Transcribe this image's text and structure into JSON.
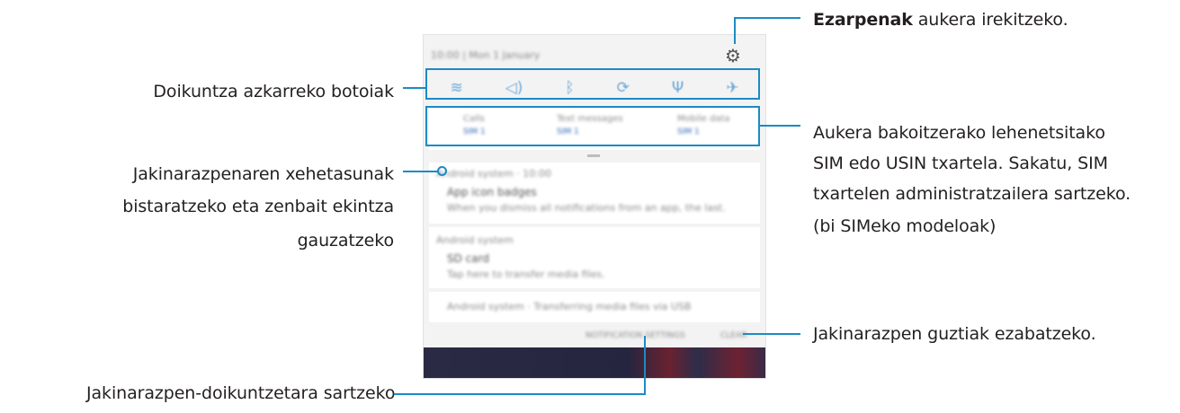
{
  "annotations": {
    "quick_buttons": "Doikuntza azkarreko botoiak",
    "notif_details_1": "Jakinarazpenaren xehetasunak",
    "notif_details_2": "bistaratzeko eta zenbait ekintza",
    "notif_details_3": "gauzatzeko",
    "notif_settings": "Jakinarazpen-doikuntzetara sartzeko",
    "settings_bold": "Ezarpenak",
    "settings_rest": " aukera irekitzeko.",
    "sim_1": "Aukera bakoitzerako lehenetsitako",
    "sim_2": "SIM edo USIN txartela. Sakatu, SIM",
    "sim_3": "txartelen administratzailera sartzeko.",
    "sim_4": "(bi SIMeko modeloak)",
    "clear_all": "Jakinarazpen guztiak ezabatzeko."
  },
  "panel": {
    "status": "10:00  |  Mon 1 January",
    "gear_icon": "gear-icon",
    "quick_settings": [
      {
        "icon": "wifi-icon",
        "glyph": "ᯤ"
      },
      {
        "icon": "sound-icon",
        "glyph": "🔈"
      },
      {
        "icon": "bluetooth-icon",
        "glyph": "ᛒ"
      },
      {
        "icon": "auto-rotate-icon",
        "glyph": "⟳"
      },
      {
        "icon": "flashlight-icon",
        "glyph": "Ψ"
      },
      {
        "icon": "airplane-icon",
        "glyph": "✈"
      }
    ],
    "sim": [
      {
        "title": "Calls",
        "sim": "SIM 1"
      },
      {
        "title": "Text messages",
        "sim": "SIM 1"
      },
      {
        "title": "Mobile data",
        "sim": "SIM 1"
      }
    ],
    "notifications": [
      {
        "header": "Android system · 10:00",
        "title": "App icon badges",
        "body": "When you dismiss all notifications from an app, the last."
      },
      {
        "header": "Android system",
        "title": "SD card",
        "body": "Tap here to transfer media files."
      },
      {
        "header": "Android system · Transferring media files via USB"
      }
    ],
    "buttons": {
      "settings": "NOTIFICATION SETTINGS",
      "clear": "CLEAR"
    }
  }
}
